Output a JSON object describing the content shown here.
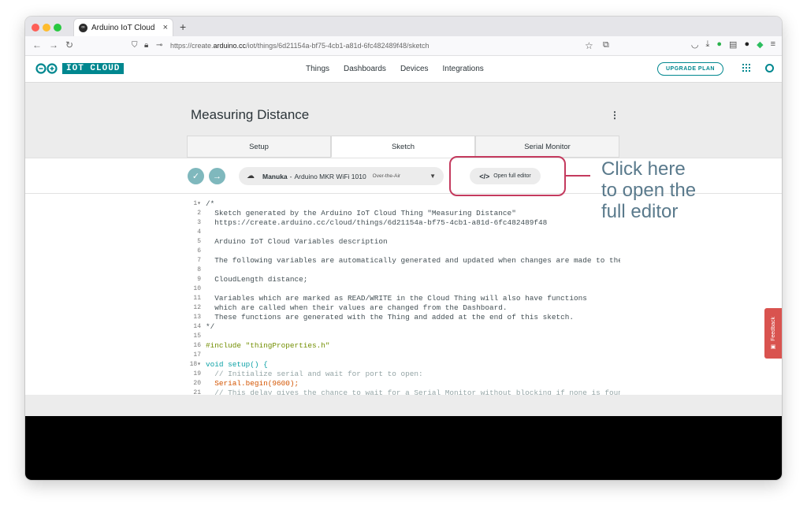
{
  "browser": {
    "tab_title": "Arduino IoT Cloud",
    "tab_close": "×",
    "new_tab": "+",
    "url_prefix": "https://create.",
    "url_domain": "arduino.cc",
    "url_path": "/iot/things/6d21154a-bf75-4cb1-a81d-6fc482489f48/sketch"
  },
  "app": {
    "logo_text": "IOT CLOUD",
    "nav": [
      "Things",
      "Dashboards",
      "Devices",
      "Integrations"
    ],
    "upgrade_label": "UPGRADE PLAN"
  },
  "thing": {
    "title": "Measuring Distance",
    "menu_icon": "⋮",
    "tabs": [
      {
        "label": "Setup",
        "active": false
      },
      {
        "label": "Sketch",
        "active": true
      },
      {
        "label": "Serial Monitor",
        "active": false
      }
    ]
  },
  "toolbar": {
    "verify_icon": "✓",
    "upload_icon": "→",
    "device_name": "Manuka",
    "device_sep": "-",
    "device_board": "Arduino MKR WiFi 1010",
    "device_mode": "Over-the-Air",
    "open_editor_label": "Open full editor",
    "open_editor_icon": "</>"
  },
  "annotation": {
    "callout_text": "Click here\nto open the\nfull editor",
    "color": "#c43a5e"
  },
  "feedback": {
    "label": "Feedback"
  },
  "code": [
    {
      "n": "1▾",
      "t": "/*"
    },
    {
      "n": "2",
      "t": "  Sketch generated by the Arduino IoT Cloud Thing \"Measuring Distance\""
    },
    {
      "n": "3",
      "t": "  https://create.arduino.cc/cloud/things/6d21154a-bf75-4cb1-a81d-6fc482489f48"
    },
    {
      "n": "4",
      "t": ""
    },
    {
      "n": "5",
      "t": "  Arduino IoT Cloud Variables description"
    },
    {
      "n": "6",
      "t": ""
    },
    {
      "n": "7",
      "t": "  The following variables are automatically generated and updated when changes are made to the"
    },
    {
      "n": "8",
      "t": ""
    },
    {
      "n": "9",
      "t": "  CloudLength distance;"
    },
    {
      "n": "10",
      "t": ""
    },
    {
      "n": "11",
      "t": "  Variables which are marked as READ/WRITE in the Cloud Thing will also have functions"
    },
    {
      "n": "12",
      "t": "  which are called when their values are changed from the Dashboard."
    },
    {
      "n": "13",
      "t": "  These functions are generated with the Thing and added at the end of this sketch."
    },
    {
      "n": "14",
      "t": "*/"
    },
    {
      "n": "15",
      "t": ""
    },
    {
      "n": "16",
      "t": "#include \"thingProperties.h\"",
      "cls": "include"
    },
    {
      "n": "17",
      "t": ""
    },
    {
      "n": "18▾",
      "t": "void setup() {",
      "cls": "setup"
    },
    {
      "n": "19",
      "t": "  // Initialize serial and wait for port to open:",
      "cls": "cm"
    },
    {
      "n": "20",
      "t": "  Serial.begin(9600);",
      "cls": "serial"
    },
    {
      "n": "21",
      "t": "  // This delay gives the chance to wait for a Serial Monitor without blocking if none is found",
      "cls": "cm"
    }
  ],
  "colors": {
    "brand_teal": "#00878f",
    "feedback_red": "#d9534f"
  }
}
